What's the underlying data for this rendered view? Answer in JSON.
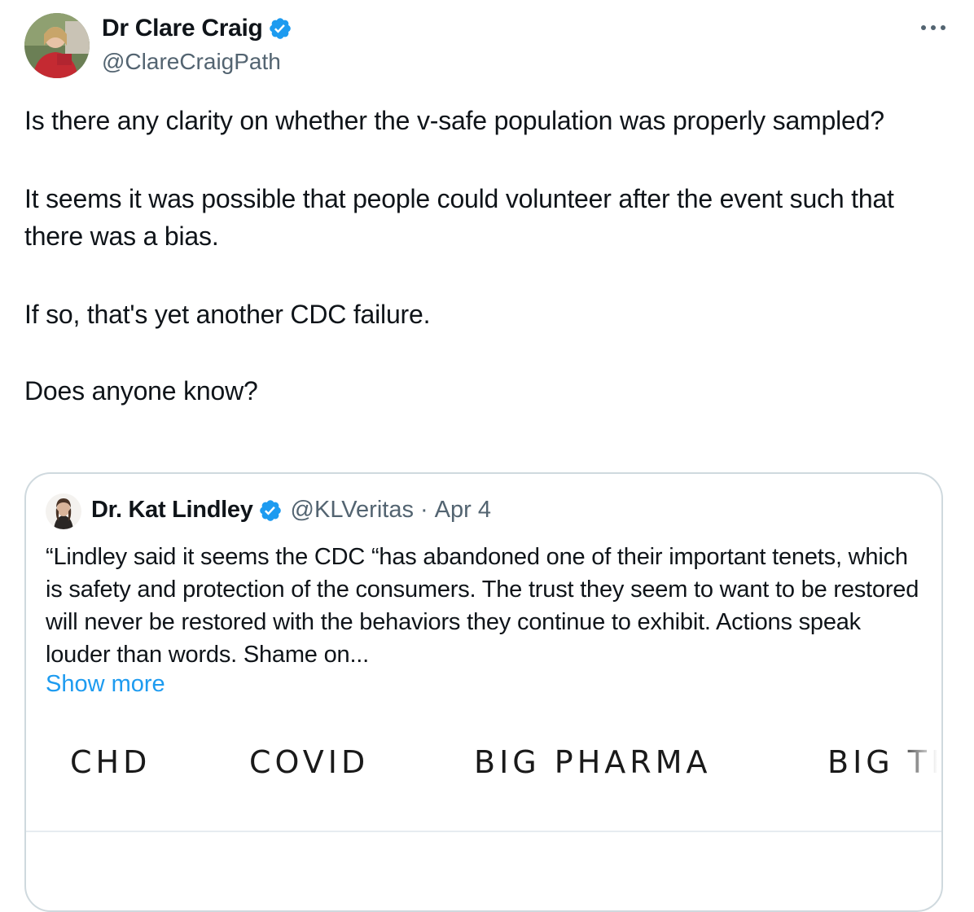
{
  "tweet": {
    "author_name": "Dr Clare Craig",
    "author_handle": "@ClareCraigPath",
    "paragraphs": [
      "Is there any clarity on whether the v-safe population was properly sampled?",
      "It seems it was possible that people could volunteer after the event such that there was a bias.",
      "If so, that's yet another CDC failure.",
      "Does anyone know?"
    ]
  },
  "quote": {
    "author_name": "Dr. Kat Lindley",
    "author_handle": "@KLVeritas",
    "separator": "·",
    "date": "Apr 4",
    "text": "“Lindley said it seems the CDC “has abandoned one of their important tenets, which is safety and protection of the consumers. The trust they seem to want to be restored will never be restored with the behaviors they continue to exhibit. Actions speak louder than words. Shame on...",
    "show_more_label": "Show more",
    "nav_items": [
      "CHD",
      "COVID",
      "BIG PHARMA",
      "BIG TE"
    ]
  },
  "colors": {
    "verified_badge": "#1d9bf0",
    "link": "#1d9bf0",
    "secondary_text": "#536471",
    "border": "#cfd9de"
  },
  "icons": {
    "more": "more-horizontal-icon",
    "verified": "verified-badge-icon"
  }
}
